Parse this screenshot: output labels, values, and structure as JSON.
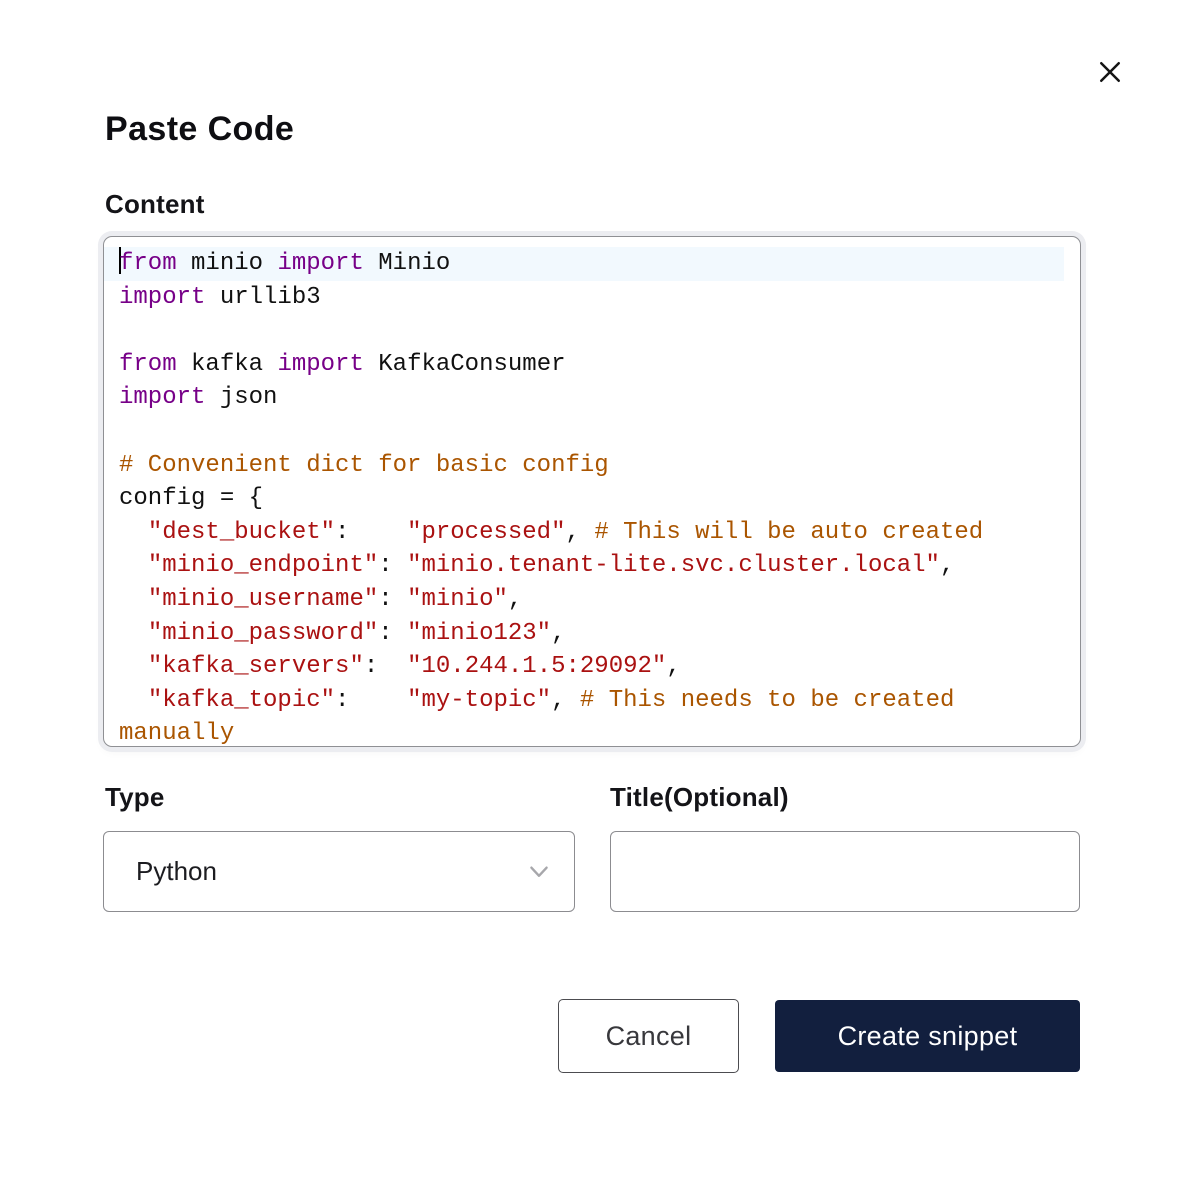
{
  "colors": {
    "accent": "#121F3E",
    "keyword": "#770088",
    "string": "#AA1111",
    "comment": "#AA5500",
    "activeline": "#F2F9FE"
  },
  "dialog": {
    "title": "Paste Code"
  },
  "content": {
    "label": "Content",
    "code": {
      "language": "python",
      "active_line": 0,
      "plain_text": "from minio import Minio\nimport urllib3\n\nfrom kafka import KafkaConsumer\nimport json\n\n# Convenient dict for basic config\nconfig = {\n  \"dest_bucket\":    \"processed\", # This will be auto created\n  \"minio_endpoint\": \"minio.tenant-lite.svc.cluster.local\",\n  \"minio_username\": \"minio\",\n  \"minio_password\": \"minio123\",\n  \"kafka_servers\":  \"10.244.1.5:29092\",\n  \"kafka_topic\":    \"my-topic\", # This needs to be created manually",
      "lines": [
        [
          {
            "t": "kw",
            "s": "from"
          },
          {
            "t": "p",
            "s": " minio "
          },
          {
            "t": "kw",
            "s": "import"
          },
          {
            "t": "p",
            "s": " Minio"
          }
        ],
        [
          {
            "t": "kw",
            "s": "import"
          },
          {
            "t": "p",
            "s": " urllib3"
          }
        ],
        [],
        [
          {
            "t": "kw",
            "s": "from"
          },
          {
            "t": "p",
            "s": " kafka "
          },
          {
            "t": "kw",
            "s": "import"
          },
          {
            "t": "p",
            "s": " KafkaConsumer"
          }
        ],
        [
          {
            "t": "kw",
            "s": "import"
          },
          {
            "t": "p",
            "s": " json"
          }
        ],
        [],
        [
          {
            "t": "com",
            "s": "# Convenient dict for basic config"
          }
        ],
        [
          {
            "t": "p",
            "s": "config = {"
          }
        ],
        [
          {
            "t": "p",
            "s": "  "
          },
          {
            "t": "str",
            "s": "\"dest_bucket\""
          },
          {
            "t": "p",
            "s": ":    "
          },
          {
            "t": "str",
            "s": "\"processed\""
          },
          {
            "t": "p",
            "s": ", "
          },
          {
            "t": "com",
            "s": "# This will be auto created"
          }
        ],
        [
          {
            "t": "p",
            "s": "  "
          },
          {
            "t": "str",
            "s": "\"minio_endpoint\""
          },
          {
            "t": "p",
            "s": ": "
          },
          {
            "t": "str",
            "s": "\"minio.tenant-lite.svc.cluster.local\""
          },
          {
            "t": "p",
            "s": ","
          }
        ],
        [
          {
            "t": "p",
            "s": "  "
          },
          {
            "t": "str",
            "s": "\"minio_username\""
          },
          {
            "t": "p",
            "s": ": "
          },
          {
            "t": "str",
            "s": "\"minio\""
          },
          {
            "t": "p",
            "s": ","
          }
        ],
        [
          {
            "t": "p",
            "s": "  "
          },
          {
            "t": "str",
            "s": "\"minio_password\""
          },
          {
            "t": "p",
            "s": ": "
          },
          {
            "t": "str",
            "s": "\"minio123\""
          },
          {
            "t": "p",
            "s": ","
          }
        ],
        [
          {
            "t": "p",
            "s": "  "
          },
          {
            "t": "str",
            "s": "\"kafka_servers\""
          },
          {
            "t": "p",
            "s": ":  "
          },
          {
            "t": "str",
            "s": "\"10.244.1.5:29092\""
          },
          {
            "t": "p",
            "s": ","
          }
        ],
        [
          {
            "t": "p",
            "s": "  "
          },
          {
            "t": "str",
            "s": "\"kafka_topic\""
          },
          {
            "t": "p",
            "s": ":    "
          },
          {
            "t": "str",
            "s": "\"my-topic\""
          },
          {
            "t": "p",
            "s": ", "
          },
          {
            "t": "com",
            "s": "# This needs to be created manually"
          }
        ]
      ]
    }
  },
  "fields": {
    "type": {
      "label": "Type",
      "value": "Python"
    },
    "title": {
      "label": "Title(Optional)",
      "value": "",
      "placeholder": ""
    }
  },
  "actions": {
    "cancel_label": "Cancel",
    "submit_label": "Create snippet"
  }
}
